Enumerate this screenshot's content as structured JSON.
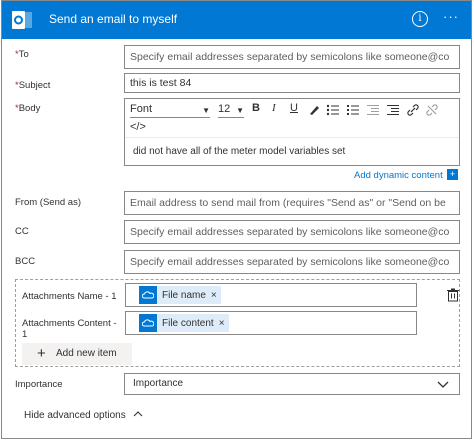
{
  "header": {
    "title": "Send an email to myself",
    "info_glyph": "i",
    "more_glyph": "···",
    "accent": "#0078d4"
  },
  "fields": {
    "to": {
      "label": "To",
      "placeholder": "Specify email addresses separated by semicolons like someone@co"
    },
    "subject": {
      "label": "Subject",
      "value": "this is test 84"
    },
    "body": {
      "label": "Body",
      "value": "did not have all of the meter model variables set"
    },
    "from": {
      "label": "From (Send as)",
      "placeholder": "Email address to send mail from (requires \"Send as\" or \"Send on be"
    },
    "cc": {
      "label": "CC",
      "placeholder": "Specify email addresses separated by semicolons like someone@co"
    },
    "bcc": {
      "label": "BCC",
      "placeholder": "Specify email addresses separated by semicolons like someone@co"
    }
  },
  "required_mark": "*",
  "editor": {
    "font": "Font",
    "size": "12",
    "code_glyph": "</>"
  },
  "add_dynamic_content": "Add dynamic content",
  "attachments": {
    "name_label": "Attachments Name - 1",
    "name_token": "File name",
    "content_label": "Attachments Content -",
    "content_label_2": "1",
    "content_token": "File content",
    "token_remove": "×",
    "add_item": "Add new item",
    "add_plus": "+"
  },
  "importance": {
    "label": "Importance",
    "value": "Importance"
  },
  "hide_advanced": "Hide advanced options"
}
